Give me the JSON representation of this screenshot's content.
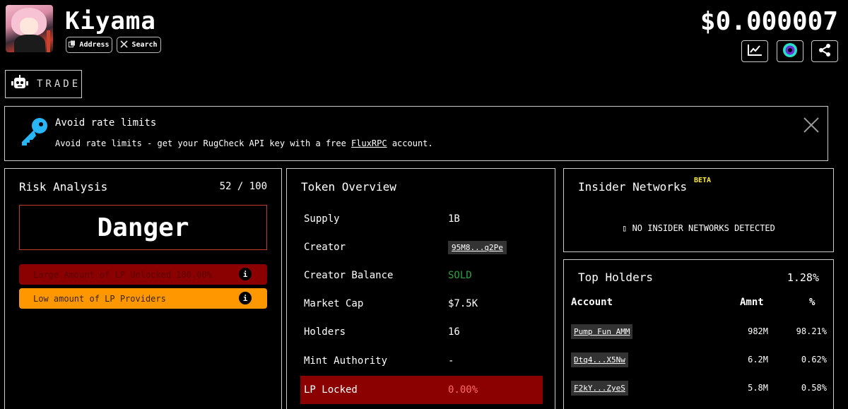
{
  "header": {
    "token_name": "Kiyama",
    "address_label": "Address",
    "search_label": "Search",
    "price": "$0.000007"
  },
  "trade_label": "TRADE",
  "banner": {
    "title": "Avoid rate limits",
    "text_before": "Avoid rate limits - get your RugCheck API key with a free ",
    "link": "FluxRPC",
    "text_after": " account."
  },
  "risk": {
    "title": "Risk Analysis",
    "score": "52 / 100",
    "level": "Danger",
    "items": [
      {
        "label": "Large Amount of LP Unlocked 100.00%",
        "severity": "danger",
        "color": "#8b0000"
      },
      {
        "label": "Low amount of LP Providers",
        "severity": "warn",
        "color": "#ff9800"
      }
    ]
  },
  "overview": {
    "title": "Token Overview",
    "rows": [
      {
        "label": "Supply",
        "value": "1B"
      },
      {
        "label": "Creator",
        "value": "95M8...q2Pe"
      },
      {
        "label": "Creator Balance",
        "value": "SOLD"
      },
      {
        "label": "Market Cap",
        "value": "$7.5K"
      },
      {
        "label": "Holders",
        "value": "16"
      },
      {
        "label": "Mint Authority",
        "value": "-"
      },
      {
        "label": "LP Locked",
        "value": "0.00%"
      }
    ]
  },
  "insider": {
    "title": "Insider Networks",
    "badge": "BETA",
    "message": "NO INSIDER NETWORKS DETECTED"
  },
  "holders": {
    "title": "Top Holders",
    "total_pct": "1.28%",
    "columns": [
      "Account",
      "Amnt",
      "%"
    ],
    "rows": [
      {
        "account": "Pump Fun AMM",
        "amount": "982M",
        "pct": "98.21%"
      },
      {
        "account": "Dtq4...X5Nw",
        "amount": "6.2M",
        "pct": "0.62%"
      },
      {
        "account": "F2kY...ZyeS",
        "amount": "5.8M",
        "pct": "0.58%"
      }
    ]
  },
  "colors": {
    "accent_blue": "#29b6f6",
    "danger": "#8b0000",
    "warning": "#ff9800",
    "success": "#2ea043",
    "beta": "#ffeb3b"
  }
}
